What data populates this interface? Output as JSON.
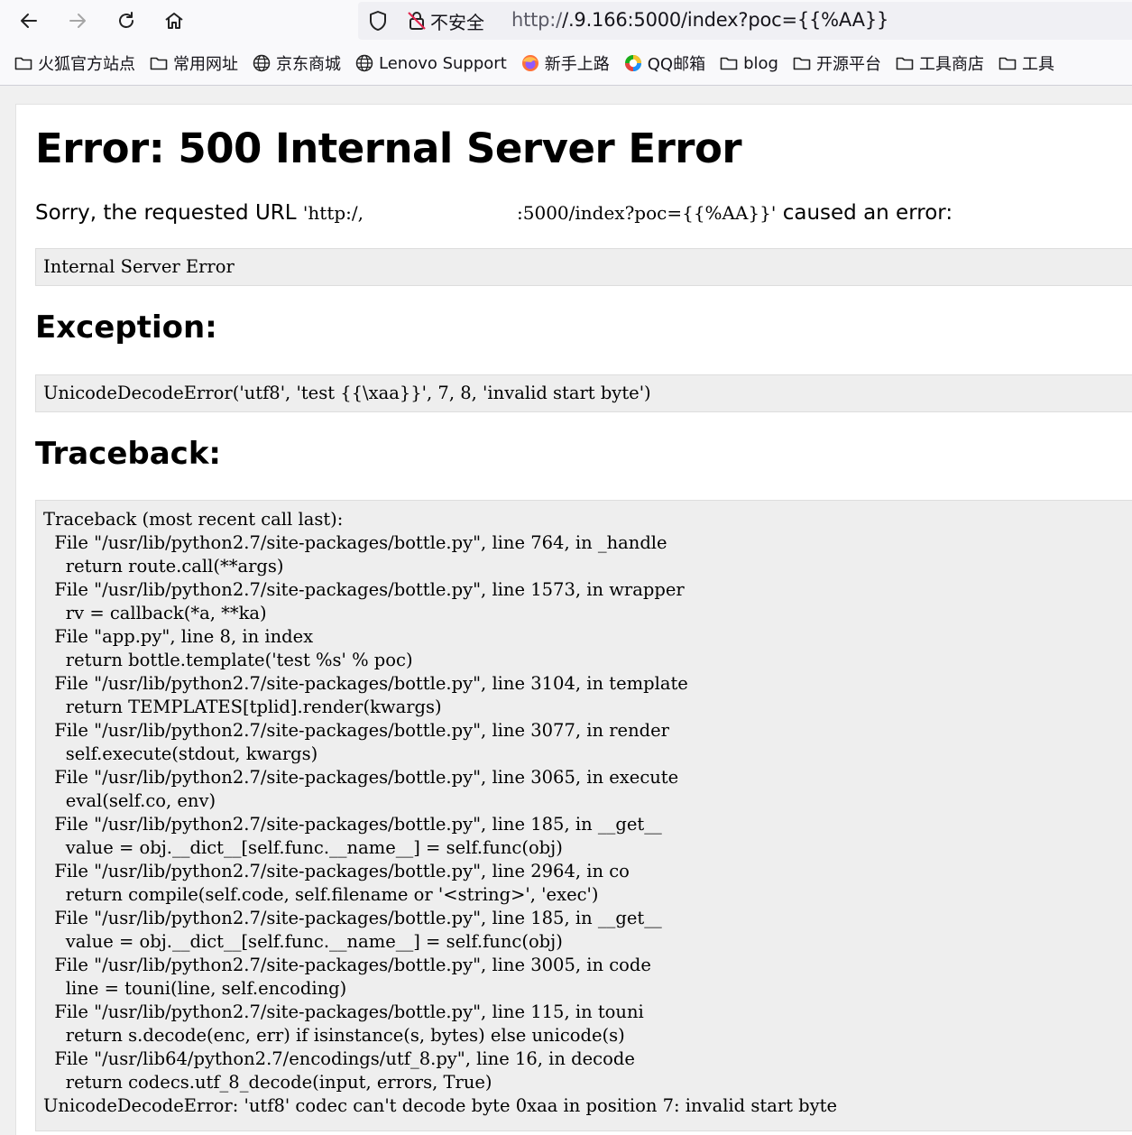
{
  "browser": {
    "security_label": "不安全",
    "url_prefix": "http:/",
    "url_hidden_host": "/.",
    "url_suffix": "9.166:5000/index?poc={{%AA}}"
  },
  "bookmarks": [
    {
      "label": "火狐官方站点",
      "icon": "folder-icon"
    },
    {
      "label": "常用网址",
      "icon": "folder-icon"
    },
    {
      "label": "京东商城",
      "icon": "globe-icon"
    },
    {
      "label": "Lenovo Support",
      "icon": "globe-icon"
    },
    {
      "label": "新手上路",
      "icon": "firefox-icon"
    },
    {
      "label": "QQ邮箱",
      "icon": "qq-mail-icon"
    },
    {
      "label": "blog",
      "icon": "folder-icon"
    },
    {
      "label": "开源平台",
      "icon": "folder-icon"
    },
    {
      "label": "工具商店",
      "icon": "folder-icon"
    },
    {
      "label": "工具",
      "icon": "folder-icon"
    }
  ],
  "page": {
    "title": "Error: 500 Internal Server Error",
    "sorry_prefix": "Sorry, the requested URL ",
    "url_start": "'http:/,",
    "url_end": ":5000/index?poc={{%AA}}'",
    "sorry_suffix": " caused an error:",
    "error_text": "Internal Server Error",
    "exception_heading": "Exception:",
    "exception_text": "UnicodeDecodeError('utf8', 'test {{\\xaa}}', 7, 8, 'invalid start byte')",
    "traceback_heading": "Traceback:",
    "traceback_text": "Traceback (most recent call last):\n  File \"/usr/lib/python2.7/site-packages/bottle.py\", line 764, in _handle\n    return route.call(**args)\n  File \"/usr/lib/python2.7/site-packages/bottle.py\", line 1573, in wrapper\n    rv = callback(*a, **ka)\n  File \"app.py\", line 8, in index\n    return bottle.template('test %s' % poc)\n  File \"/usr/lib/python2.7/site-packages/bottle.py\", line 3104, in template\n    return TEMPLATES[tplid].render(kwargs)\n  File \"/usr/lib/python2.7/site-packages/bottle.py\", line 3077, in render\n    self.execute(stdout, kwargs)\n  File \"/usr/lib/python2.7/site-packages/bottle.py\", line 3065, in execute\n    eval(self.co, env)\n  File \"/usr/lib/python2.7/site-packages/bottle.py\", line 185, in __get__\n    value = obj.__dict__[self.func.__name__] = self.func(obj)\n  File \"/usr/lib/python2.7/site-packages/bottle.py\", line 2964, in co\n    return compile(self.code, self.filename or '<string>', 'exec')\n  File \"/usr/lib/python2.7/site-packages/bottle.py\", line 185, in __get__\n    value = obj.__dict__[self.func.__name__] = self.func(obj)\n  File \"/usr/lib/python2.7/site-packages/bottle.py\", line 3005, in code\n    line = touni(line, self.encoding)\n  File \"/usr/lib/python2.7/site-packages/bottle.py\", line 115, in touni\n    return s.decode(enc, err) if isinstance(s, bytes) else unicode(s)\n  File \"/usr/lib64/python2.7/encodings/utf_8.py\", line 16, in decode\n    return codecs.utf_8_decode(input, errors, True)\nUnicodeDecodeError: 'utf8' codec can't decode byte 0xaa in position 7: invalid start byte"
  }
}
